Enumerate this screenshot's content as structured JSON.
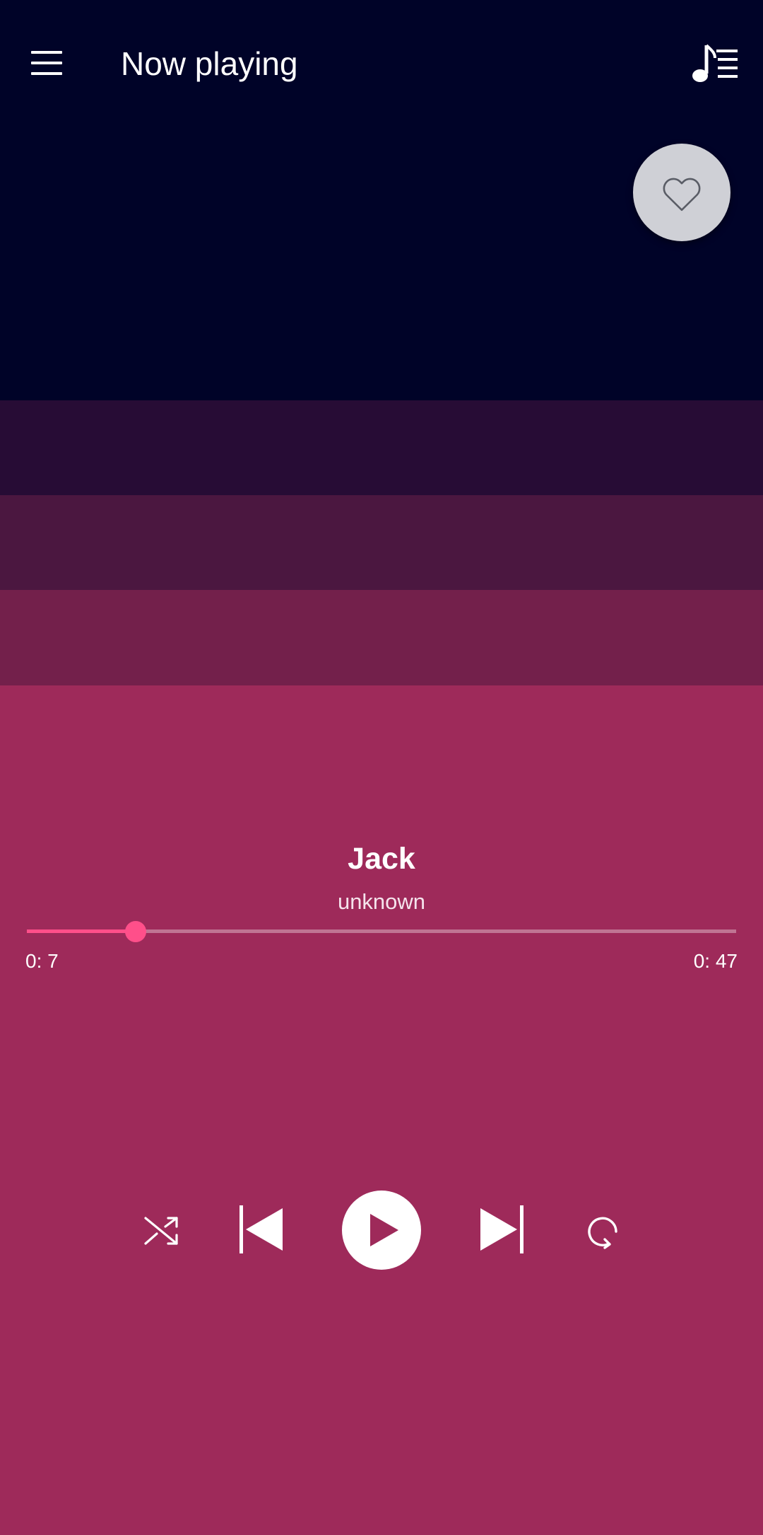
{
  "header": {
    "title": "Now playing"
  },
  "track": {
    "title": "Jack",
    "artist": "unknown"
  },
  "playback": {
    "current_time": "0: 7",
    "duration": "0: 47",
    "progress": 0.153,
    "state": "paused"
  },
  "colors": {
    "accent": "#ff4f8a",
    "top_background": "#000328",
    "bottom_background": "#9e2a5a",
    "favorite_button": "#cfd0d6"
  },
  "icons": {
    "menu": "hamburger-menu-icon",
    "queue": "music-queue-icon",
    "favorite": "heart-outline-icon",
    "shuffle": "shuffle-icon",
    "previous": "skip-previous-icon",
    "play": "play-icon",
    "next": "skip-next-icon",
    "repeat": "repeat-icon"
  }
}
